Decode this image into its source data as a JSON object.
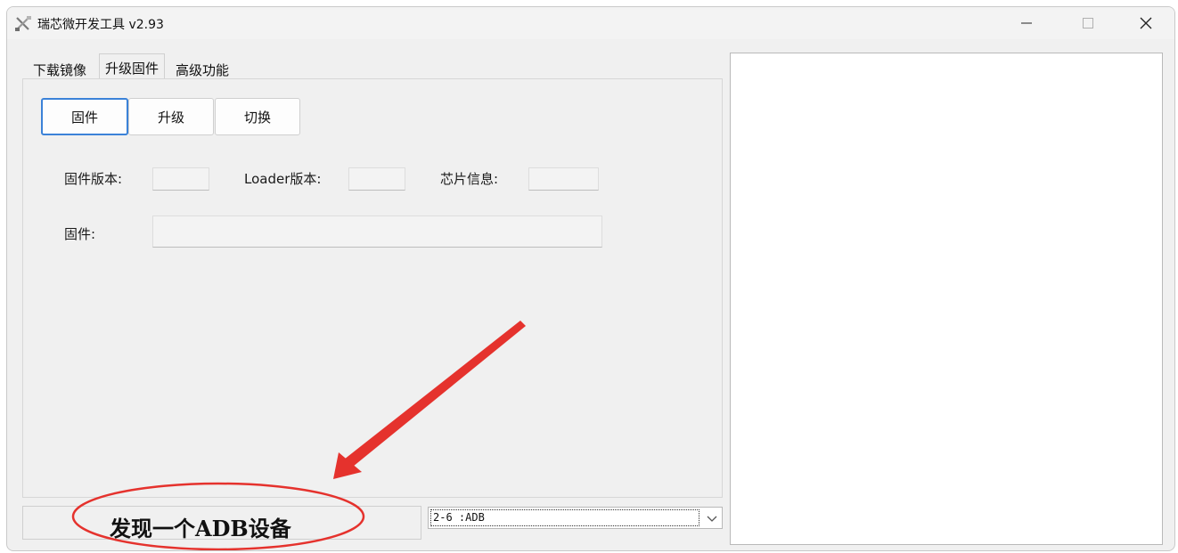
{
  "window": {
    "title": "瑞芯微开发工具 v2.93",
    "app_icon": "tools-icon"
  },
  "tabs": [
    {
      "label": "下载镜像"
    },
    {
      "label": "升级固件",
      "active": true
    },
    {
      "label": "高级功能"
    }
  ],
  "toolbar": {
    "firmware_label": "固件",
    "upgrade_label": "升级",
    "switch_label": "切换"
  },
  "info": {
    "firmware_version_label": "固件版本:",
    "firmware_version_value": "",
    "loader_version_label": "Loader版本:",
    "loader_version_value": "",
    "chip_info_label": "芯片信息:",
    "chip_info_value": "",
    "firmware_label": "固件:",
    "firmware_path_value": ""
  },
  "status": {
    "text": "发现一个ADB设备"
  },
  "device": {
    "selected": "2-6  :ADB"
  },
  "colors": {
    "annotation_red": "#e5322d",
    "focus_blue": "#3b82d8",
    "window_bg": "#f0f0f0"
  }
}
